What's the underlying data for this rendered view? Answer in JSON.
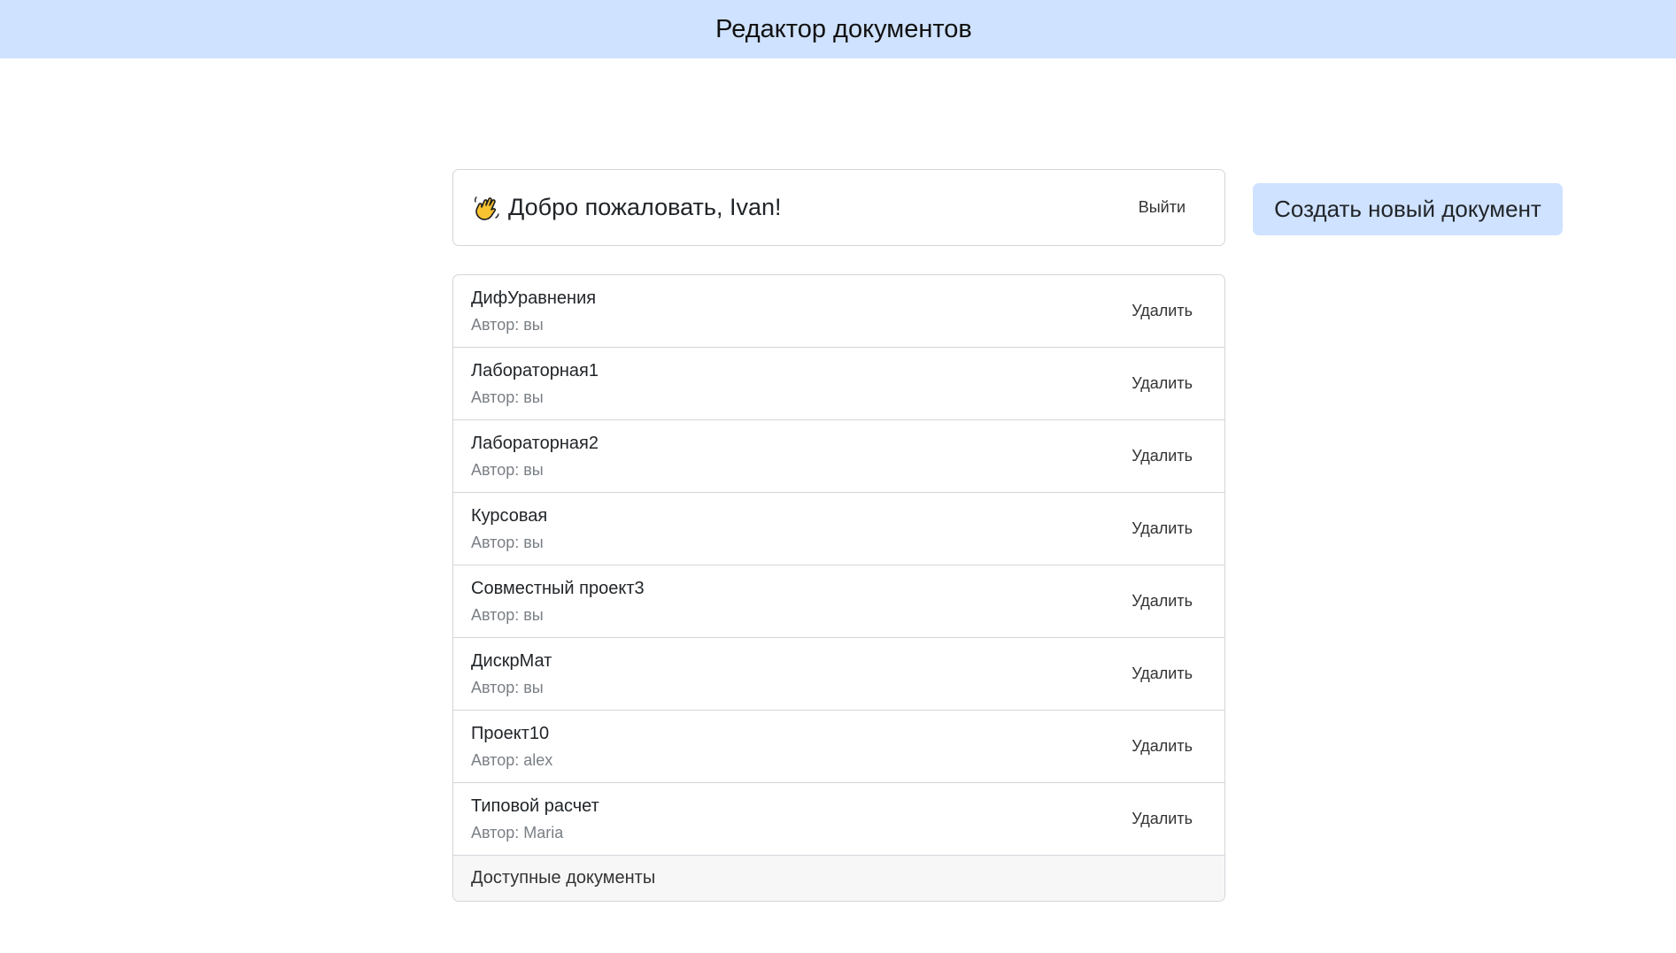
{
  "header": {
    "title": "Редактор документов",
    "background": "#cfe2ff"
  },
  "welcome": {
    "icon": "waving-hand-icon",
    "text": "Добро пожаловать, Ivan!",
    "logout_label": "Выйти"
  },
  "create_button": {
    "label": "Создать новый документ",
    "color": "#cfe2ff"
  },
  "documents": [
    {
      "title": "ДифУравнения",
      "author": "Автор: вы",
      "delete_label": "Удалить"
    },
    {
      "title": "Лабораторная1",
      "author": "Автор: вы",
      "delete_label": "Удалить"
    },
    {
      "title": "Лабораторная2",
      "author": "Автор: вы",
      "delete_label": "Удалить"
    },
    {
      "title": "Курсовая",
      "author": "Автор: вы",
      "delete_label": "Удалить"
    },
    {
      "title": "Совместный проект3",
      "author": "Автор: вы",
      "delete_label": "Удалить"
    },
    {
      "title": "ДискрМат",
      "author": "Автор: вы",
      "delete_label": "Удалить"
    },
    {
      "title": "Проект10",
      "author": "Автор: alex",
      "delete_label": "Удалить"
    },
    {
      "title": "Типовой расчет",
      "author": "Автор: Maria",
      "delete_label": "Удалить"
    }
  ],
  "list_footer": "Доступные документы"
}
